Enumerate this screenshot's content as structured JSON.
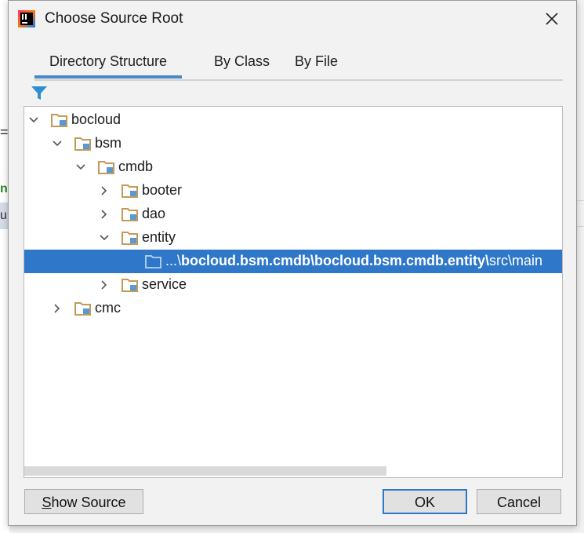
{
  "window": {
    "title": "Choose Source Root"
  },
  "tabs": [
    {
      "label": "Directory Structure",
      "active": true
    },
    {
      "label": "By Class",
      "active": false
    },
    {
      "label": "By File",
      "active": false
    }
  ],
  "tree": {
    "items": [
      {
        "label": "bocloud",
        "depth": 0,
        "expanded": true
      },
      {
        "label": "bsm",
        "depth": 1,
        "expanded": true
      },
      {
        "label": "cmdb",
        "depth": 2,
        "expanded": true
      },
      {
        "label": "booter",
        "depth": 3,
        "expanded": false
      },
      {
        "label": "dao",
        "depth": 3,
        "expanded": false
      },
      {
        "label": "entity",
        "depth": 3,
        "expanded": true
      },
      {
        "label": "service",
        "depth": 3,
        "expanded": false
      },
      {
        "label": "cmc",
        "depth": 1,
        "expanded": false
      }
    ],
    "selected": {
      "prefix": "...\\",
      "bold_part": "bocloud.bsm.cmdb\\bocloud.bsm.cmdb.entity\\",
      "suffix": "src\\main"
    }
  },
  "buttons": {
    "show_source_first": "S",
    "show_source_rest": "how Source",
    "ok": "OK",
    "cancel": "Cancel"
  },
  "background": {
    "left_eq": "=",
    "left_n": "n",
    "left_u": "u"
  },
  "colors": {
    "selection": "#2f77c8",
    "tab_underline": "#4a88c7",
    "folder": "#c49a5a",
    "filter": "#2f8fd1"
  },
  "icons": {
    "app": "intellij-icon",
    "close": "close-icon",
    "filter": "filter-icon",
    "folder": "folder-icon",
    "chevron": "chevron-icon"
  }
}
